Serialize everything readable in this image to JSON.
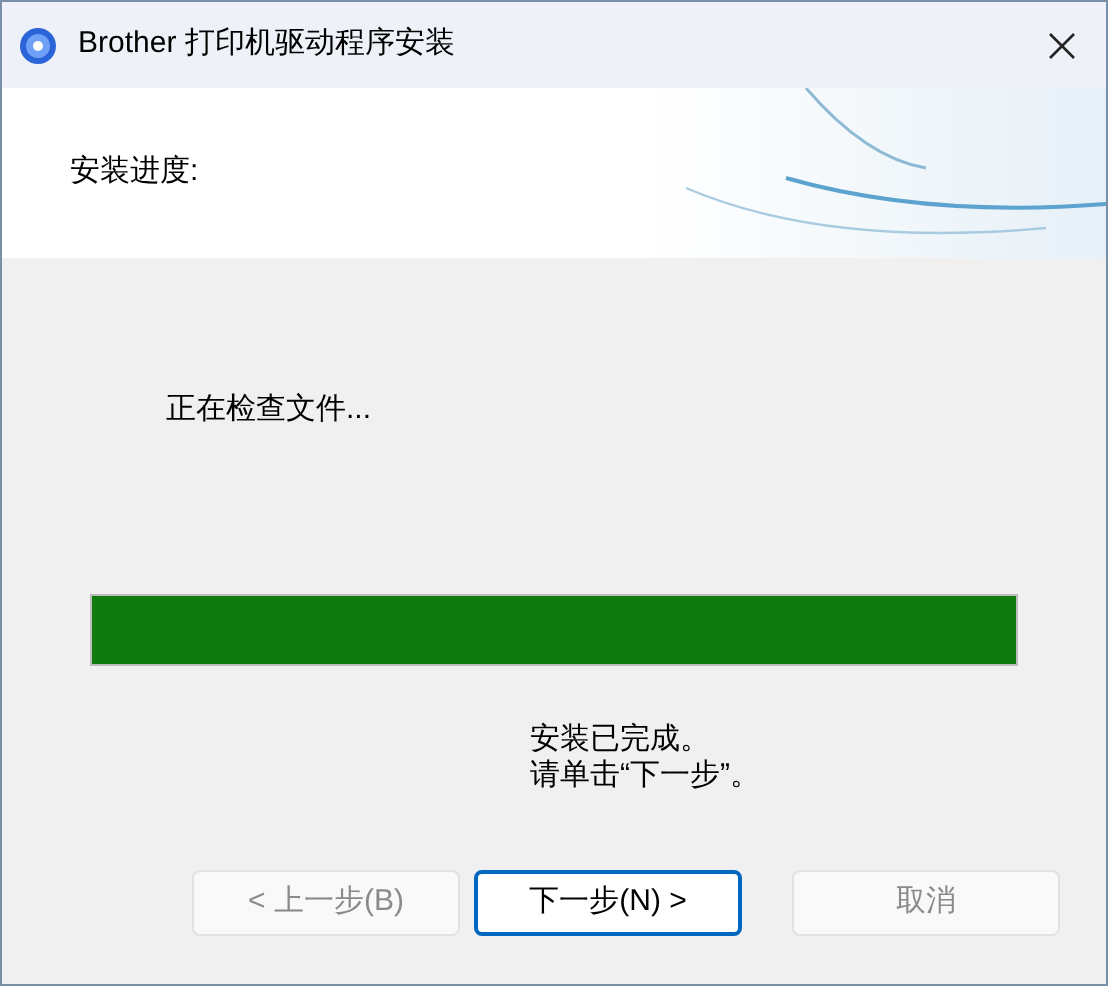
{
  "window": {
    "title": "Brother 打印机驱动程序安装"
  },
  "header": {
    "title": "安装进度:"
  },
  "status": "正在检查文件...",
  "progress": {
    "level": 1
  },
  "message": [
    "安装已完成。",
    "请单击“下一步”。"
  ],
  "buttons": [
    {
      "label": "< 上一步(B)",
      "disabled": true,
      "selected": false
    },
    {
      "label": "下一步(N) >",
      "disabled": false,
      "selected": true
    },
    {
      "label": "取消",
      "disabled": true,
      "selected": false
    }
  ]
}
